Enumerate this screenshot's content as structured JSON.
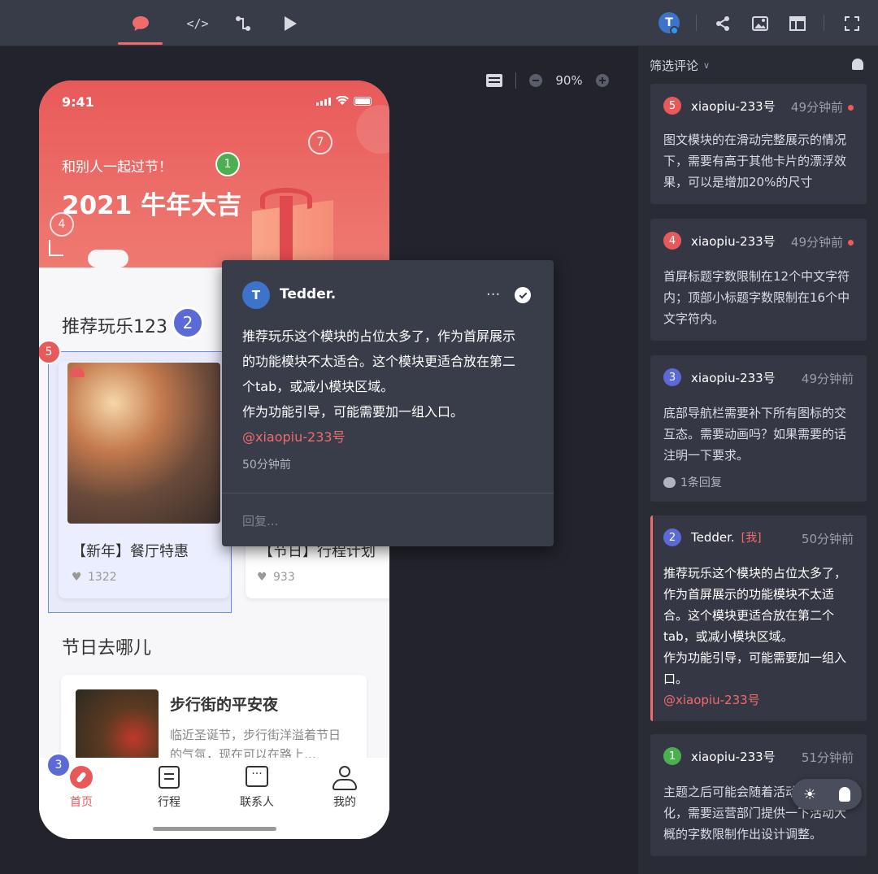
{
  "topbar": {
    "icons": [
      "comment-icon",
      "code-icon",
      "flow-icon",
      "play-icon"
    ],
    "right_icons": [
      "share-icon",
      "image-icon",
      "layout-icon",
      "fullscreen-icon"
    ],
    "user_initial": "T",
    "accent": "#f06b6b"
  },
  "zoom": {
    "value": "90%"
  },
  "phone": {
    "time": "9:41",
    "header_subtitle": "和别人一起过节！",
    "header_title": "2021 牛年大吉",
    "section1_title": "推荐玩乐123",
    "cards": [
      {
        "title": "【新年】餐厅特惠",
        "likes": "1322"
      },
      {
        "title": "【节日】行程计划",
        "likes": "933"
      }
    ],
    "section2_title": "节日去哪儿",
    "article": {
      "title": "步行街的平安夜",
      "desc": "临近圣诞节，步行街洋溢着节日的气氛，现在可以在路上…"
    },
    "tabs": [
      "首页",
      "行程",
      "联系人",
      "我的"
    ],
    "markers": [
      "1",
      "2",
      "3",
      "4",
      "5",
      "7"
    ]
  },
  "popup": {
    "author": "Tedder.",
    "initial": "T",
    "text_lines": [
      "推荐玩乐这个模块的占位太多了，作为首屏展示",
      "的功能模块不太适合。这个模块更适合放在第二",
      "个tab，或减小模块区域。",
      "作为功能引导，可能需要加一组入口。"
    ],
    "mention": "@xiaopiu-233号",
    "time": "50分钟前",
    "reply_placeholder": "回复..."
  },
  "panel": {
    "filter_label": "筛选评论",
    "comments": [
      {
        "num": "5",
        "color": "#e85a5a",
        "author": "xiaopiu-233号",
        "time": "49分钟前",
        "lines": [
          "图文模块的在滑动完整展示的情况",
          "下，需要有高于其他卡片的漂浮效",
          "果，可以是增加20%的尺寸"
        ]
      },
      {
        "num": "4",
        "color": "#e85a5a",
        "author": "xiaopiu-233号",
        "time": "49分钟前",
        "lines": [
          "首屏标题字数限制在12个中文字符",
          "内；顶部小标题字数限制在16个中",
          "文字符内。"
        ]
      },
      {
        "num": "3",
        "color": "#5b6ad6",
        "author": "xiaopiu-233号",
        "time": "49分钟前",
        "lines": [
          "底部导航栏需要补下所有图标的交",
          "互态。需要动画吗？如果需要的话",
          "注明一下要求。"
        ],
        "replies": "1条回复"
      },
      {
        "num": "2",
        "color": "#5b6ad6",
        "author": "Tedder.",
        "me": "[我]",
        "time": "50分钟前",
        "lines": [
          "推荐玩乐这个模块的占位太多了，",
          "作为首屏展示的功能模块不太适",
          "合。这个模块更适合放在第二个",
          "tab，或减小模块区域。",
          "作为功能引导，可能需要加一组入",
          "口。"
        ],
        "mention": "@xiaopiu-233号"
      },
      {
        "num": "1",
        "color": "#4caf50",
        "author": "xiaopiu-233号",
        "time": "51分钟前",
        "lines": [
          "主题之后可能会随着活动",
          "化，需要运营部门提供一下活动大",
          "概的字数限制作出设计调整。"
        ]
      }
    ]
  }
}
